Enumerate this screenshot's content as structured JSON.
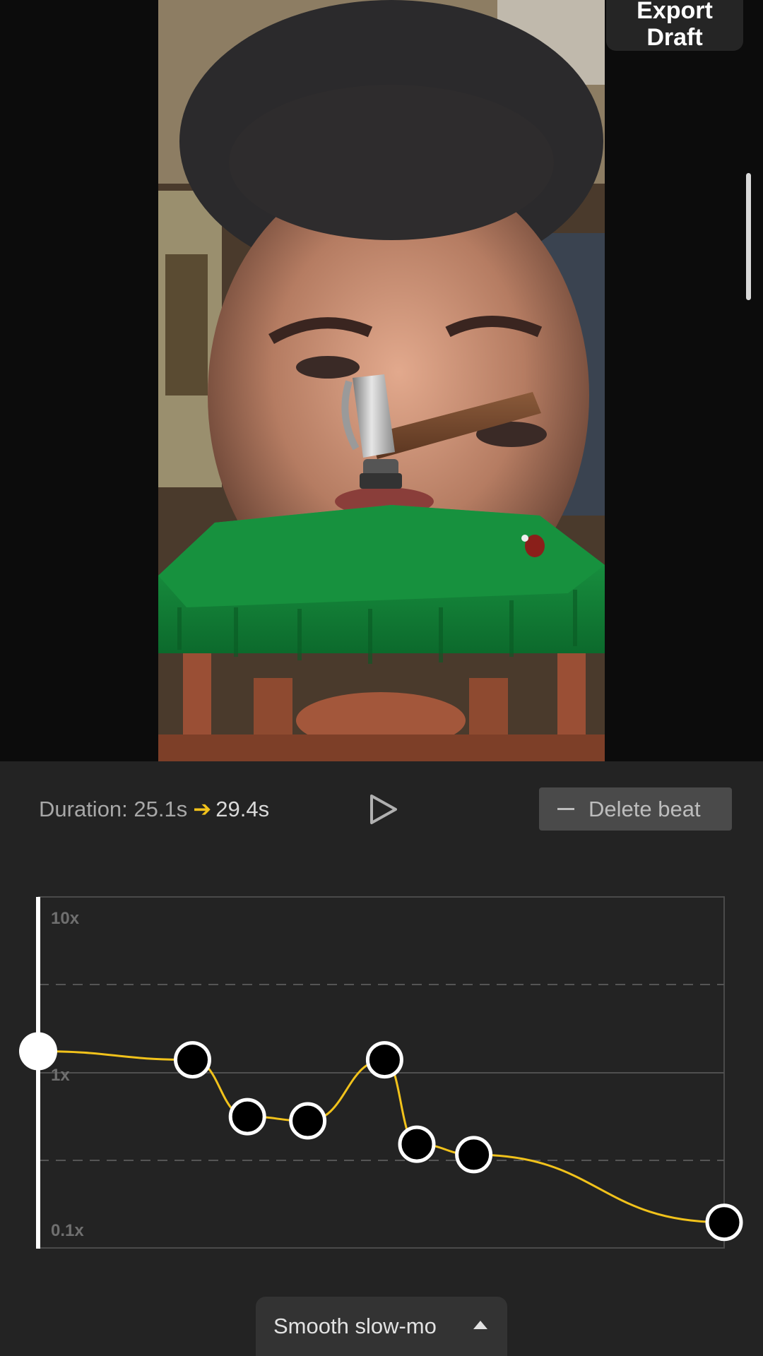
{
  "header": {
    "export_label_line1": "Export",
    "export_label_line2": "Draft"
  },
  "controls": {
    "duration_label": "Duration:",
    "duration_original": "25.1s",
    "duration_arrow": "➔",
    "duration_new": "29.4s",
    "delete_beat_label": "Delete beat"
  },
  "speed_graph": {
    "y_axis_labels": [
      "10x",
      "1x",
      "0.1x"
    ],
    "playhead_speed": 1.32,
    "curve_color": "#f1c21b",
    "beat_speeds": [
      1.18,
      0.56,
      0.53,
      1.18,
      0.39,
      0.34,
      0.14
    ],
    "beat_positions": [
      0.225,
      0.305,
      0.393,
      0.505,
      0.552,
      0.635,
      1.0
    ]
  },
  "preset": {
    "label": "Smooth slow-mo",
    "caret_icon": "caret-up-icon"
  },
  "colors": {
    "accent": "#f1c21b",
    "background": "#232323"
  }
}
